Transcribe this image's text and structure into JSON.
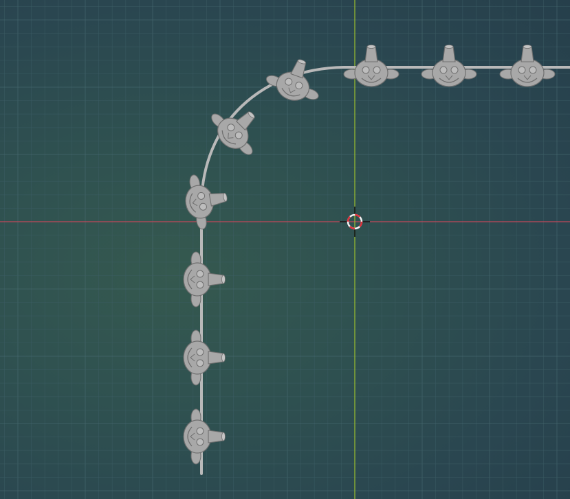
{
  "viewport": {
    "name": "3d-viewport",
    "colors": {
      "grid_minor": "#3d5e66",
      "grid_major": "#4a6d74",
      "axis_x": "#c0485a",
      "axis_y": "#9bbf2e",
      "curve": "#b9b9b9",
      "mesh": "#a8a8a8",
      "mesh_shadow": "#6f6f6f",
      "cursor_red": "#e0303a",
      "cursor_white": "#f2f2f2"
    }
  },
  "scene": {
    "objects": [
      "bezier-curve",
      "monkey-array",
      "3d-cursor"
    ],
    "monkey_count": 10
  }
}
